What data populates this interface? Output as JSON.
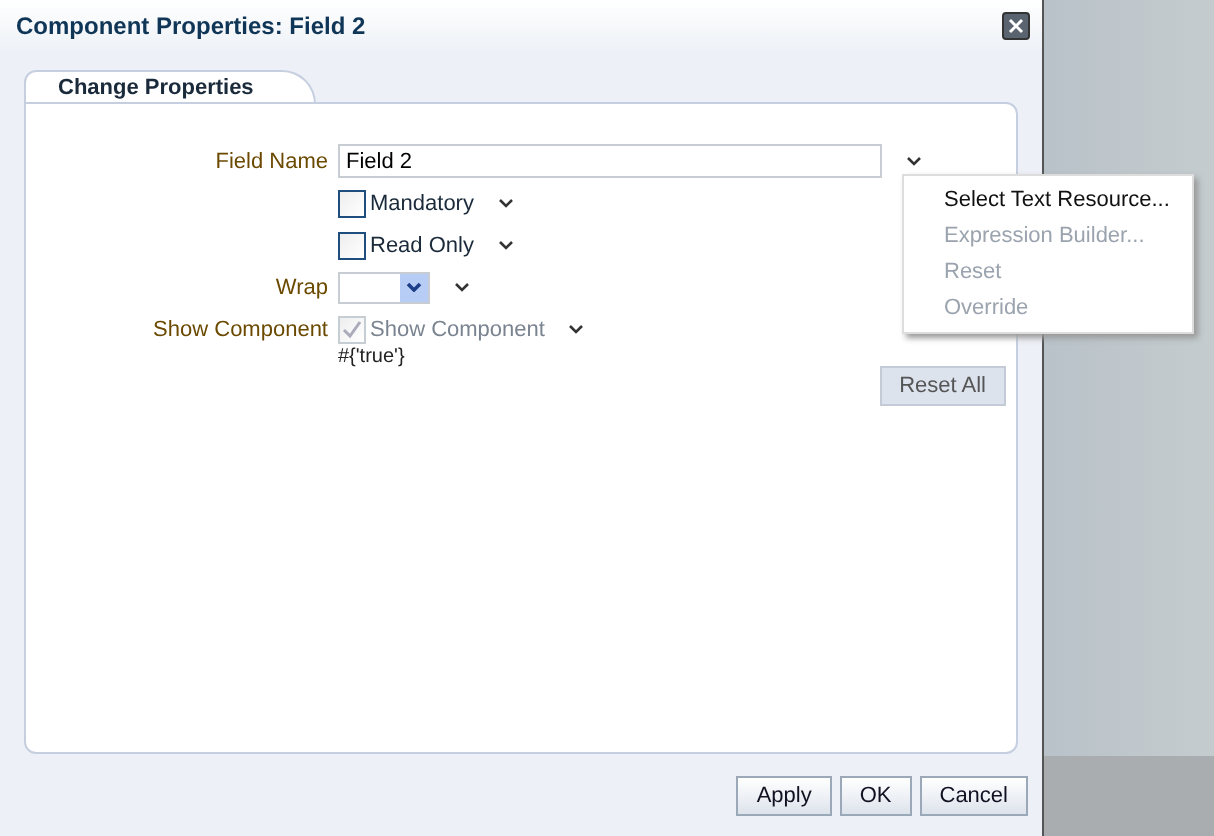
{
  "window": {
    "title": "Component Properties: Field 2"
  },
  "tabs": [
    {
      "label": "Change Properties",
      "selected": true
    }
  ],
  "form": {
    "rows": [
      {
        "kind": "text",
        "label": "Field Name",
        "value": "Field 2"
      },
      {
        "kind": "checkbox",
        "text": "Mandatory",
        "checked": false,
        "disabled": false
      },
      {
        "kind": "checkbox",
        "text": "Read Only",
        "checked": false,
        "disabled": false
      },
      {
        "kind": "select",
        "label": "Wrap"
      },
      {
        "kind": "checkbox",
        "label": "Show Component",
        "text": "Show Component",
        "checked": true,
        "disabled": true,
        "expression": "#{'true'}"
      }
    ]
  },
  "menu": {
    "items": [
      {
        "label": "Select Text Resource...",
        "disabled": false
      },
      {
        "label": "Expression Builder...",
        "disabled": true
      },
      {
        "label": "Reset",
        "disabled": true
      },
      {
        "label": "Override",
        "disabled": true
      }
    ]
  },
  "reset_all": "Reset All",
  "buttons": [
    "Apply",
    "OK",
    "Cancel"
  ]
}
